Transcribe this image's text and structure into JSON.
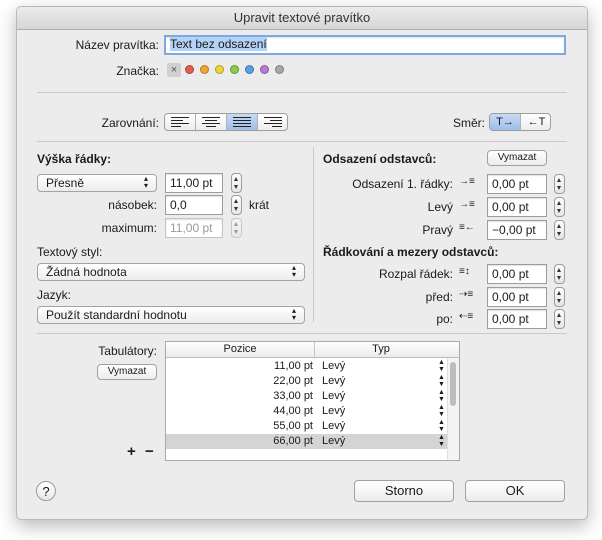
{
  "window": {
    "title": "Upravit textové pravítko"
  },
  "name_label": "Název pravítka:",
  "name_value": "Text bez odsazení",
  "tag_label": "Značka:",
  "tag_colors": [
    "#e05d4f",
    "#f0a535",
    "#efd637",
    "#8ccb4a",
    "#5a9fe6",
    "#b77ad3",
    "#a8a8a8"
  ],
  "alignment_label": "Zarovnání:",
  "alignment_selected": "justify",
  "direction": {
    "label": "Směr:",
    "ltr": "T→",
    "rtl": "←T",
    "selected": "ltr"
  },
  "line_height": {
    "heading": "Výška řádky:",
    "mode": "Přesně",
    "value": "11,00 pt",
    "multiple_label": "násobek:",
    "multiple_value": "0,0",
    "multiple_unit": "krát",
    "maximum_label": "maximum:",
    "maximum_value": "11,00 pt"
  },
  "text_style": {
    "label": "Textový styl:",
    "value": "Žádná hodnota"
  },
  "language": {
    "label": "Jazyk:",
    "value": "Použít standardní hodnotu"
  },
  "indents": {
    "heading": "Odsazení odstavců:",
    "clear": "Vymazat",
    "first_line_label": "Odsazení 1. řádky:",
    "first_line_value": "0,00 pt",
    "left_label": "Levý",
    "left_value": "0,00 pt",
    "right_label": "Pravý",
    "right_value": "−0,00 pt"
  },
  "spacing": {
    "heading": "Řádkování a mezery odstavců:",
    "line_spacing_label": "Rozpal řádek:",
    "line_spacing_value": "0,00 pt",
    "before_label": "před:",
    "before_value": "0,00 pt",
    "after_label": "po:",
    "after_value": "0,00 pt"
  },
  "tabs": {
    "label": "Tabulátory:",
    "clear": "Vymazat",
    "add": "+",
    "remove": "−",
    "col_position": "Pozice",
    "col_type": "Typ",
    "rows": [
      {
        "position": "11,00 pt",
        "type": "Levý"
      },
      {
        "position": "22,00 pt",
        "type": "Levý"
      },
      {
        "position": "33,00 pt",
        "type": "Levý"
      },
      {
        "position": "44,00 pt",
        "type": "Levý"
      },
      {
        "position": "55,00 pt",
        "type": "Levý"
      },
      {
        "position": "66,00 pt",
        "type": "Levý"
      },
      {
        "position": "",
        "type": ""
      }
    ],
    "selected_row": 5
  },
  "footer": {
    "help": "?",
    "cancel": "Storno",
    "ok": "OK"
  }
}
